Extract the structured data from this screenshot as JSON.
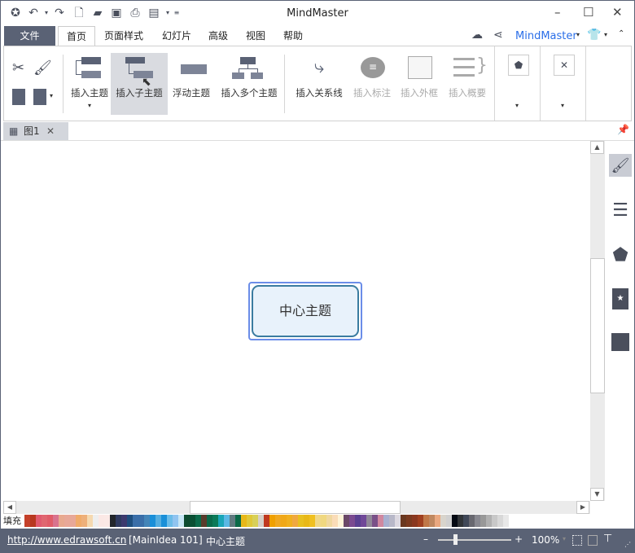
{
  "app": {
    "title": "MindMaster"
  },
  "quick_access": [
    "app-logo-icon",
    "undo-icon",
    "dropdown-icon",
    "redo-icon",
    "new-icon",
    "open-icon",
    "save-icon",
    "print-icon",
    "export-icon",
    "dropdown-icon",
    "customize-icon"
  ],
  "window_controls": {
    "minimize": "–",
    "maximize": "☐",
    "close": "✕"
  },
  "menu_tabs": [
    {
      "label": "文件"
    },
    {
      "label": "首页"
    },
    {
      "label": "页面样式"
    },
    {
      "label": "幻灯片"
    },
    {
      "label": "高级"
    },
    {
      "label": "视图"
    },
    {
      "label": "帮助"
    }
  ],
  "account": {
    "label": "MindMaster",
    "color": "#2a6ee8"
  },
  "ribbon": {
    "buttons": [
      {
        "label": "插入主题",
        "enabled": true
      },
      {
        "label": "插入子主题",
        "enabled": true,
        "hovered": true
      },
      {
        "label": "浮动主题",
        "enabled": true
      },
      {
        "label": "插入多个主题",
        "enabled": true
      },
      {
        "label": "插入关系线",
        "enabled": true
      },
      {
        "label": "插入标注",
        "enabled": false
      },
      {
        "label": "插入外框",
        "enabled": false
      },
      {
        "label": "插入概要",
        "enabled": false
      }
    ]
  },
  "document_tab": {
    "label": "图1",
    "close": "✕"
  },
  "canvas": {
    "central_topic": "中心主题",
    "topic_fill": "#e8f2fb",
    "topic_border": "#3a7ca0",
    "selection_color": "#6b8de8"
  },
  "scroll": {
    "vertical_thumb_fraction": [
      0.33,
      0.71
    ],
    "horizontal_thumb_fraction": [
      0.32,
      0.68
    ]
  },
  "palette": {
    "label": "填充",
    "colors": [
      "#c4402a",
      "#b8381f",
      "#e05a6e",
      "#e06670",
      "#e05c68",
      "#d9738e",
      "#e8a98f",
      "#e8a898",
      "#e8a898",
      "#f0ab6a",
      "#eeb07a",
      "#f5d9b0",
      "#eeeeee",
      "#fbe8e5",
      "#fbe9e6",
      "#22262b",
      "#2e3a5f",
      "#3c3a6e",
      "#1e4e7e",
      "#3a6ea8",
      "#3a6ea8",
      "#4485b8",
      "#1a8fd8",
      "#55aee0",
      "#1a90d8",
      "#6bbce8",
      "#90c4f0",
      "#c8e6f5",
      "#0c4b30",
      "#0a5034",
      "#0b6a4a",
      "#593c2c",
      "#0a6a4a",
      "#0b7a58",
      "#1aa6b8",
      "#5ab8e4",
      "#607a80",
      "#0b6a48",
      "#e8b818",
      "#e0c838",
      "#d8d058",
      "#d6d0c8",
      "#c0391f",
      "#f0a000",
      "#f0a820",
      "#f0a818",
      "#f0b020",
      "#f0a840",
      "#e8c020",
      "#e8b818",
      "#f0c020",
      "#f0d888",
      "#f0d880",
      "#f0d8a0",
      "#fadcb8",
      "#fdf4d8",
      "#6a4868",
      "#7a4a90",
      "#5a4090",
      "#704898",
      "#908898",
      "#7a5088",
      "#d088a0",
      "#a8b0d0",
      "#b8b8c8",
      "#dcd8e0",
      "#6a3820",
      "#7a3a20",
      "#8a3820",
      "#a04020",
      "#c07848",
      "#c08860",
      "#eaa880",
      "#d8d4cc",
      "#d0d0d0",
      "#050a14",
      "#303438",
      "#404858",
      "#686870",
      "#888890",
      "#989898",
      "#b0b0b0",
      "#c8c8c8",
      "#d8d8d8",
      "#e8e8e8"
    ]
  },
  "status": {
    "url": "http://www.edrawsoft.cn",
    "selection": "[MainIdea 101]",
    "topic": "中心主题",
    "zoom": "100%",
    "zoom_minus": "–",
    "zoom_plus": "+",
    "zoom_slider_fraction": 0.2
  },
  "right_panel": [
    "format-brush-icon",
    "outline-list-icon",
    "clipart-icon",
    "mark-icon",
    "task-icon"
  ]
}
